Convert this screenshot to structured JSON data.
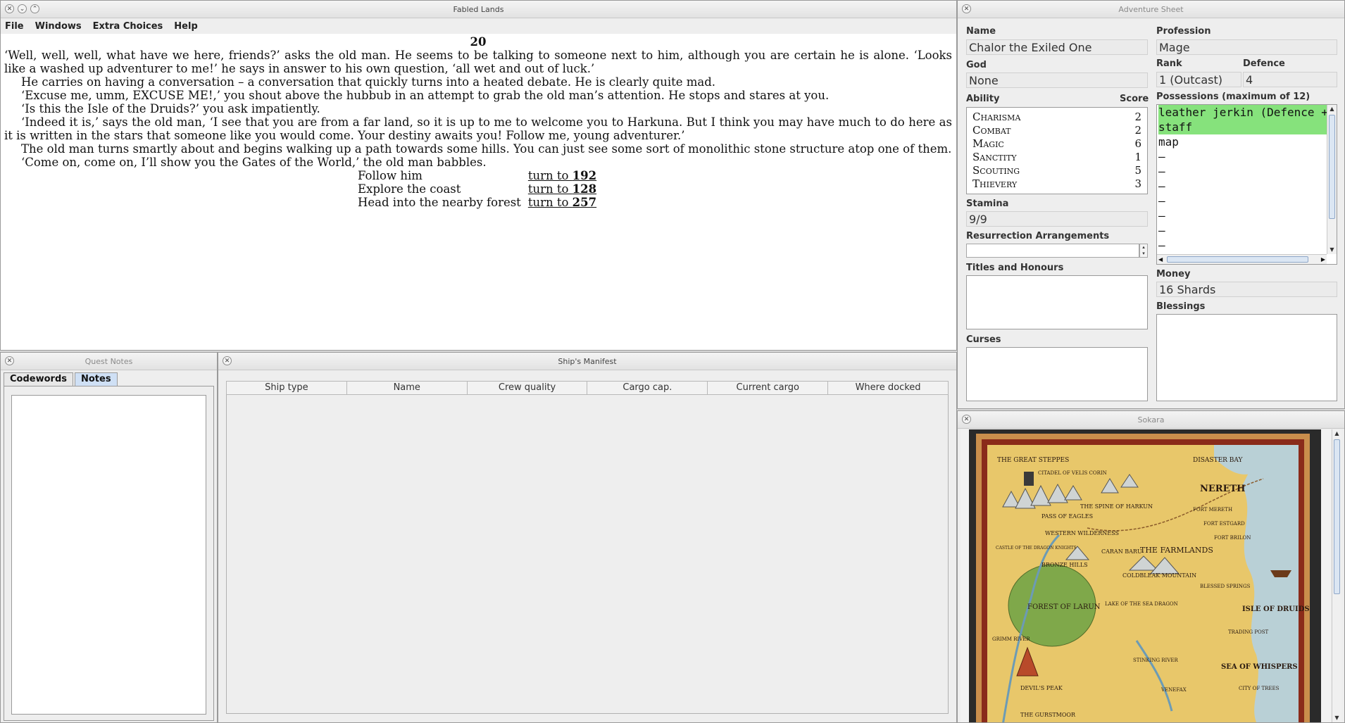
{
  "main_window": {
    "title": "Fabled Lands",
    "menu": [
      "File",
      "Windows",
      "Extra Choices",
      "Help"
    ],
    "section_number": "20",
    "paragraphs": [
      "‘Well, well, well, what have we here, friends?’ asks the old man. He seems to be talking to someone next to him, although you are certain he is alone. ‘Looks like a washed up adventurer to me!’ he says in answer to his own question, ‘all wet and out of luck.’",
      "He carries on having a conversation – a conversation that quickly turns into a heated debate. He is clearly quite mad.",
      "‘Excuse me, umm, EXCUSE ME!,’ you shout above the hubbub in an attempt to grab the old man’s attention. He stops and stares at you.",
      "‘Is this the Isle of the Druids?’ you ask impatiently.",
      "‘Indeed it is,’ says the old man, ‘I see that you are from a far land, so it is up to me to welcome you to Harkuna. But I think you may have much to do here as it is written in the stars that someone like you would come. Your destiny awaits you! Follow me, young adventurer.’",
      "The old man turns smartly about and begins walking up a path towards some hills. You can just see some sort of monolithic stone structure atop one of them.",
      "‘Come on, come on, I’ll show you the Gates of the World,’ the old man babbles."
    ],
    "choices": [
      {
        "text": "Follow him",
        "turn_label": "turn to ",
        "target": "192"
      },
      {
        "text": "Explore the coast",
        "turn_label": "turn to ",
        "target": "128"
      },
      {
        "text": "Head into the nearby forest",
        "turn_label": "turn to ",
        "target": "257"
      }
    ]
  },
  "adventure_sheet": {
    "title": "Adventure Sheet",
    "name_label": "Name",
    "name": "Chalor the Exiled One",
    "profession_label": "Profession",
    "profession": "Mage",
    "god_label": "God",
    "god": "None",
    "rank_label": "Rank",
    "rank": "1 (Outcast)",
    "defence_label": "Defence",
    "defence": "4",
    "ability_label": "Ability",
    "score_label": "Score",
    "abilities": [
      {
        "name": "Charisma",
        "score": "2"
      },
      {
        "name": "Combat",
        "score": "2"
      },
      {
        "name": "Magic",
        "score": "6"
      },
      {
        "name": "Sanctity",
        "score": "1"
      },
      {
        "name": "Scouting",
        "score": "5"
      },
      {
        "name": "Thievery",
        "score": "3"
      }
    ],
    "possessions_label": "Possessions (maximum of 12)",
    "possessions": [
      "leather jerkin (Defence +",
      "staff",
      "map",
      "—",
      "—",
      "—",
      "—",
      "—",
      "—",
      "—"
    ],
    "stamina_label": "Stamina",
    "stamina": "9/9",
    "resurrection_label": "Resurrection Arrangements",
    "titles_label": "Titles and Honours",
    "money_label": "Money",
    "money": "16 Shards",
    "blessings_label": "Blessings",
    "curses_label": "Curses"
  },
  "quest_notes": {
    "title": "Quest Notes",
    "tabs": [
      "Codewords",
      "Notes"
    ],
    "active_tab": "Notes"
  },
  "ships_manifest": {
    "title": "Ship's Manifest",
    "columns": [
      "Ship type",
      "Name",
      "Crew quality",
      "Cargo cap.",
      "Current cargo",
      "Where docked"
    ]
  },
  "map_window": {
    "title": "Sokara",
    "labels": {
      "steppes": "THE GREAT STEPPES",
      "citadel": "CITADEL OF VELIS CORIN",
      "disaster_bay": "DISASTER BAY",
      "nereth": "NERETH",
      "spine": "THE SPINE OF HARKUN",
      "pass": "PASS OF EAGLES",
      "fort_mereth": "FORT MERETH",
      "fort_estgard": "FORT ESTGARD",
      "fort_brilon": "FORT BRILON",
      "castle": "CASTLE OF THE DRAGON KNIGHTS",
      "western": "WESTERN WILDERNESS",
      "caran": "CARAN BARU",
      "farmlands": "THE FARMLANDS",
      "bronze": "BRONZE HILLS",
      "coldbleak": "COLDBLEAK MOUNTAIN",
      "blessed": "BLESSED SPRINGS",
      "forest": "FOREST OF LARUN",
      "isle": "ISLE OF DRUIDS",
      "grimm": "GRIMM RIVER",
      "lake": "LAKE OF THE SEA DRAGON",
      "trading": "TRADING POST",
      "devils": "DEVIL'S PEAK",
      "stinking": "STINKING RIVER",
      "venefax": "VENEFAX",
      "sea": "SEA OF WHISPERS",
      "city": "CITY OF TREES",
      "gurstmoor": "THE GURSTMOOR"
    }
  },
  "colors": {
    "possession_highlight": "#86e27c",
    "map_parchment": "#e8c76a",
    "map_sea": "#b9d0d6",
    "map_border": "#8a2b1a"
  }
}
